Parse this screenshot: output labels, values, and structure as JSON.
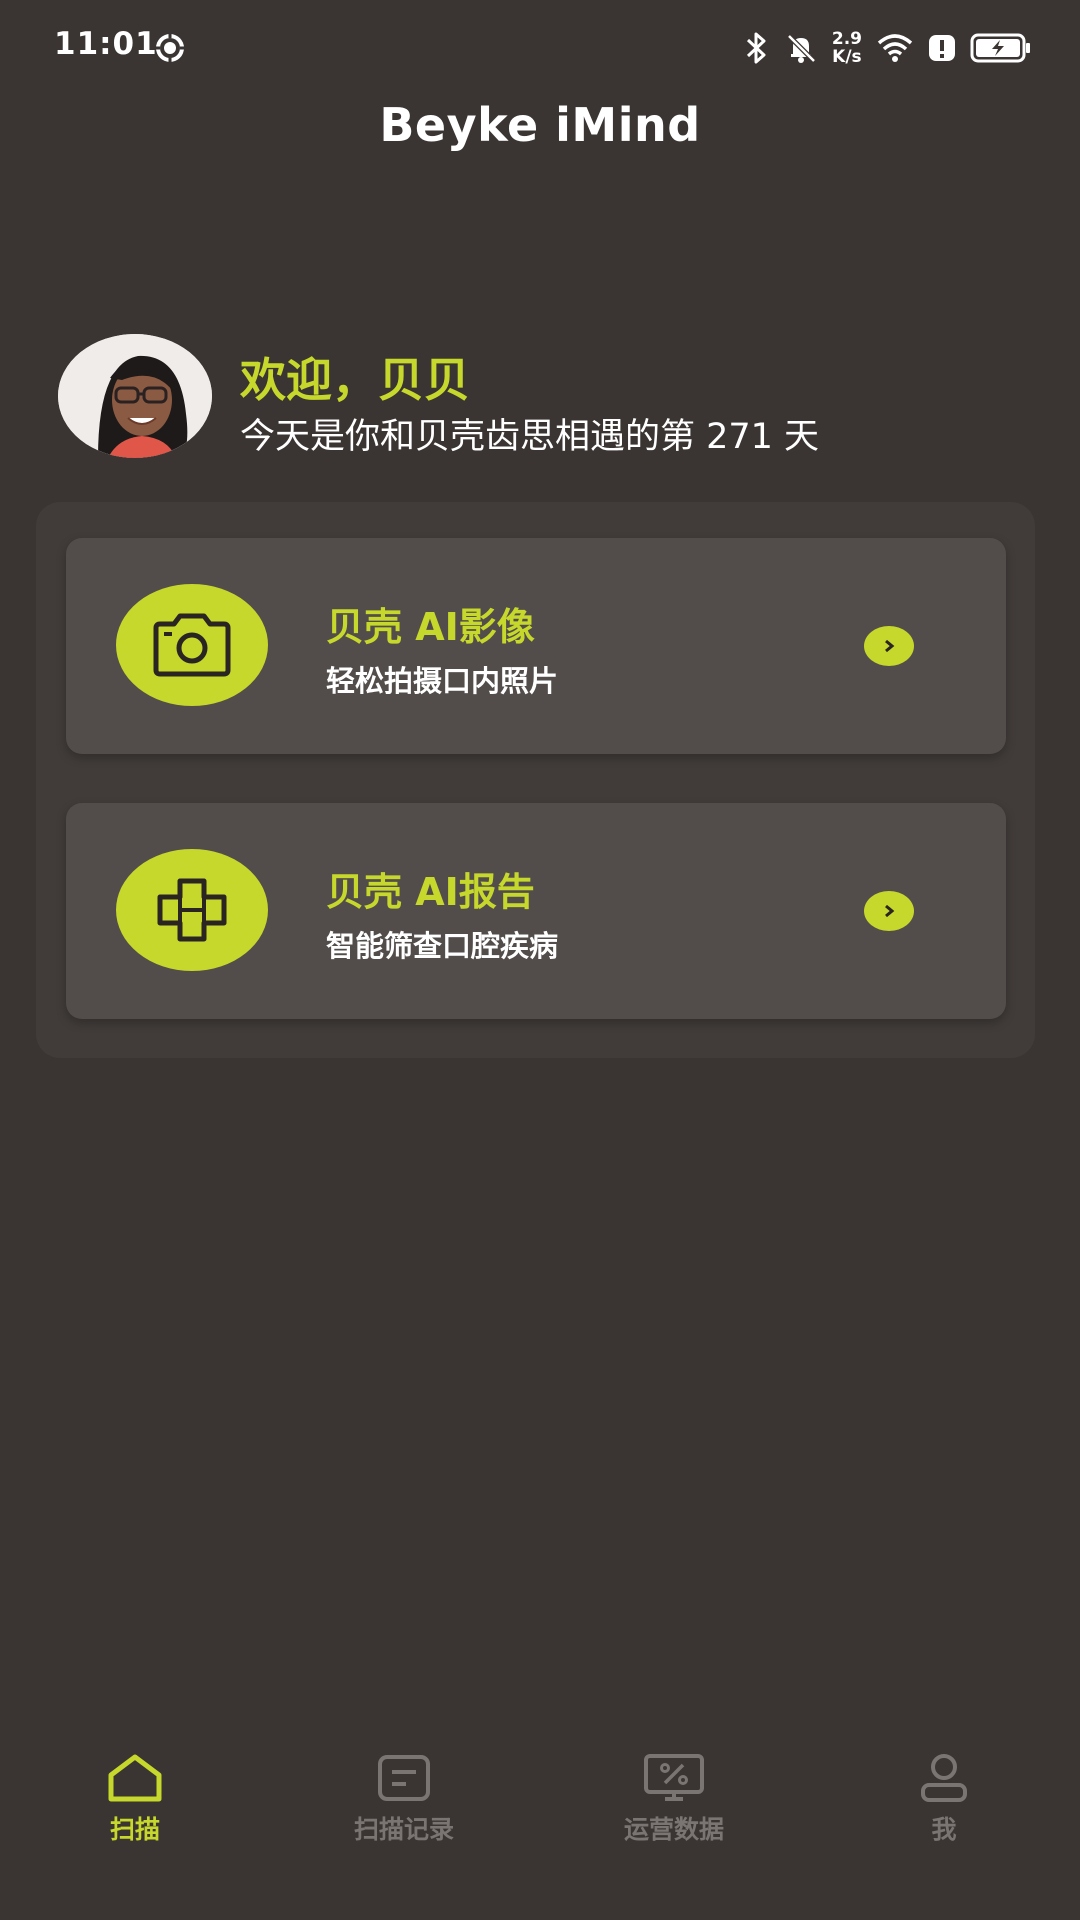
{
  "status_bar": {
    "time": "11:01",
    "net_speed_value": "2.9",
    "net_speed_unit": "K/s",
    "icons": [
      "settings-gear-icon",
      "bluetooth-icon",
      "mute-bell-icon",
      "wifi-icon",
      "alert-icon",
      "battery-charging-icon"
    ]
  },
  "header": {
    "title": "Beyke iMind"
  },
  "welcome": {
    "title": "欢迎，贝贝",
    "subtitle": "今天是你和贝壳齿思相遇的第 271 天"
  },
  "cards": [
    {
      "title": "贝壳 AI影像",
      "subtitle": "轻松拍摄口内照片",
      "icon": "camera-icon"
    },
    {
      "title": "贝壳 AI报告",
      "subtitle": "智能筛查口腔疾病",
      "icon": "cross-report-icon"
    }
  ],
  "bottom_nav": {
    "items": [
      {
        "label": "扫描",
        "icon": "home-icon",
        "active": true
      },
      {
        "label": "扫描记录",
        "icon": "record-list-icon",
        "active": false
      },
      {
        "label": "运营数据",
        "icon": "operations-data-icon",
        "active": false
      },
      {
        "label": "我",
        "icon": "user-icon",
        "active": false
      }
    ]
  },
  "colors": {
    "background": "#3a3533",
    "panel": "#413c3a",
    "card": "#524d4b",
    "accent": "#c6d82b",
    "inactive": "#7a7572"
  }
}
